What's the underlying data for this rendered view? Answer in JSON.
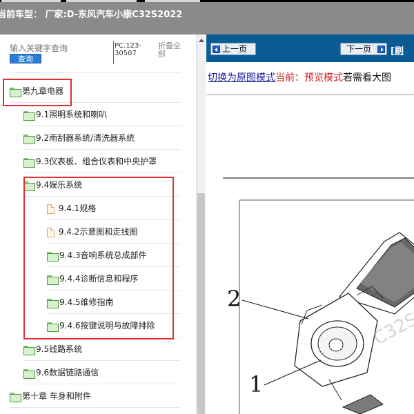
{
  "header": {
    "title": "当前车型： 厂家:D-东风汽车小康C32S2022"
  },
  "sidebar": {
    "search_placeholder": "输入关键字查询",
    "search_button": "查询",
    "pc_code": "PC.123-30507",
    "collapse_all": "折叠全部",
    "items": [
      {
        "label": "第九章电器",
        "icon": "folder-open-icon"
      },
      {
        "label": "9.1照明系统和喇叭",
        "icon": "folder-icon"
      },
      {
        "label": "9.2雨刮器系统/清洗器系统",
        "icon": "folder-icon"
      },
      {
        "label": "9.3仪表板、组合仪表和中央护罩",
        "icon": "folder-icon"
      },
      {
        "label": "9.4娱乐系统",
        "icon": "folder-open-icon"
      },
      {
        "label": "9.4.1规格",
        "icon": "document-icon"
      },
      {
        "label": "9.4.2示意图和走线图",
        "icon": "document-icon"
      },
      {
        "label": "9.4.3音响系统总成部件",
        "icon": "folder-icon"
      },
      {
        "label": "9.4.4诊断信息和程序",
        "icon": "folder-icon"
      },
      {
        "label": "9.4.5维修指南",
        "icon": "folder-icon"
      },
      {
        "label": "9.4.6按键说明与故障排除",
        "icon": "folder-icon"
      },
      {
        "label": "9.5线路系统",
        "icon": "folder-icon"
      },
      {
        "label": "9.6数据链路通信",
        "icon": "folder-icon"
      },
      {
        "label": "第十章 车身和附件",
        "icon": "folder-open-icon"
      }
    ]
  },
  "main": {
    "prev_button": "上一页",
    "next_button": "下一页",
    "nav_extra": "[刷",
    "switch_link": "切换为原图模式",
    "current_mode": "当前：预览模式",
    "hint": "若需看大图",
    "callouts": [
      "2",
      "1"
    ],
    "watermark": "C32S"
  },
  "colors": {
    "header_bg": "#8a8a8a",
    "navbar_bg": "#0b5c93",
    "highlight": "#e03030",
    "link": "#1a1aa0",
    "mode_red": "#d01818"
  }
}
